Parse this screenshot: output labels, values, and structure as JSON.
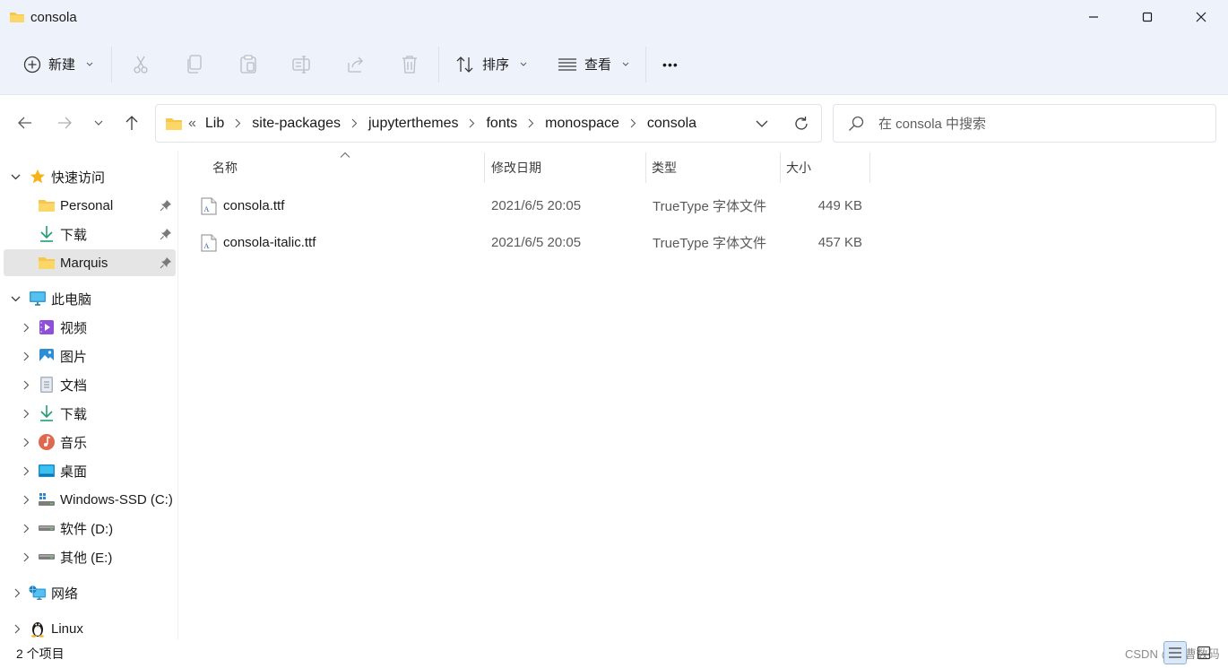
{
  "window": {
    "title": "consola"
  },
  "toolbar": {
    "new_label": "新建",
    "sort_label": "排序",
    "view_label": "查看",
    "more_label": "•••"
  },
  "address": {
    "overflow": "«",
    "crumbs": [
      "Lib",
      "site-packages",
      "jupyterthemes",
      "fonts",
      "monospace",
      "consola"
    ]
  },
  "search": {
    "placeholder": "在 consola 中搜索"
  },
  "sidebar": {
    "quick_access": "快速访问",
    "quick_items": [
      "Personal",
      "下载",
      "Marquis"
    ],
    "this_pc": "此电脑",
    "pc_items": [
      "视频",
      "图片",
      "文档",
      "下载",
      "音乐",
      "桌面",
      "Windows-SSD (C:)",
      "软件 (D:)",
      "其他 (E:)"
    ],
    "network": "网络",
    "linux": "Linux"
  },
  "columns": {
    "name": "名称",
    "date": "修改日期",
    "type": "类型",
    "size": "大小"
  },
  "files": [
    {
      "name": "consola.ttf",
      "date": "2021/6/5 20:05",
      "type": "TrueType 字体文件",
      "size": "449 KB"
    },
    {
      "name": "consola-italic.ttf",
      "date": "2021/6/5 20:05",
      "type": "TrueType 字体文件",
      "size": "457 KB"
    }
  ],
  "status": {
    "count": "2 个项目",
    "watermark": "CSDN @小曹数码"
  },
  "colors": {
    "chrome_bg": "#eef3fb",
    "selection": "#e5e5e5",
    "folder": "#f8c648",
    "accent": "#0067c0"
  }
}
